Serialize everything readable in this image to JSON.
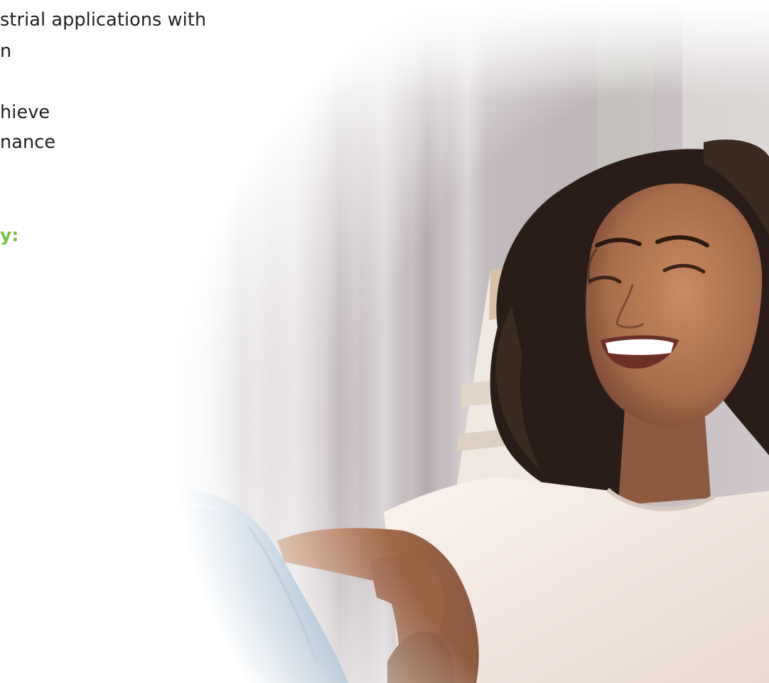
{
  "copy": {
    "line_1": "strial applications with",
    "line_2": "n",
    "line_3": "hieve",
    "line_4": "nance",
    "accent_text": "y:"
  },
  "colors": {
    "accent": "#7cc242",
    "body_text": "#1f1f1f",
    "curtain": "#cbc2c4",
    "shirt": "#f4e8e2",
    "jeans": "#90b1cd",
    "skin": "#a8714f",
    "hair": "#2a1d17"
  },
  "image": {
    "subject": "smiling-woman-relaxing-in-chair"
  }
}
